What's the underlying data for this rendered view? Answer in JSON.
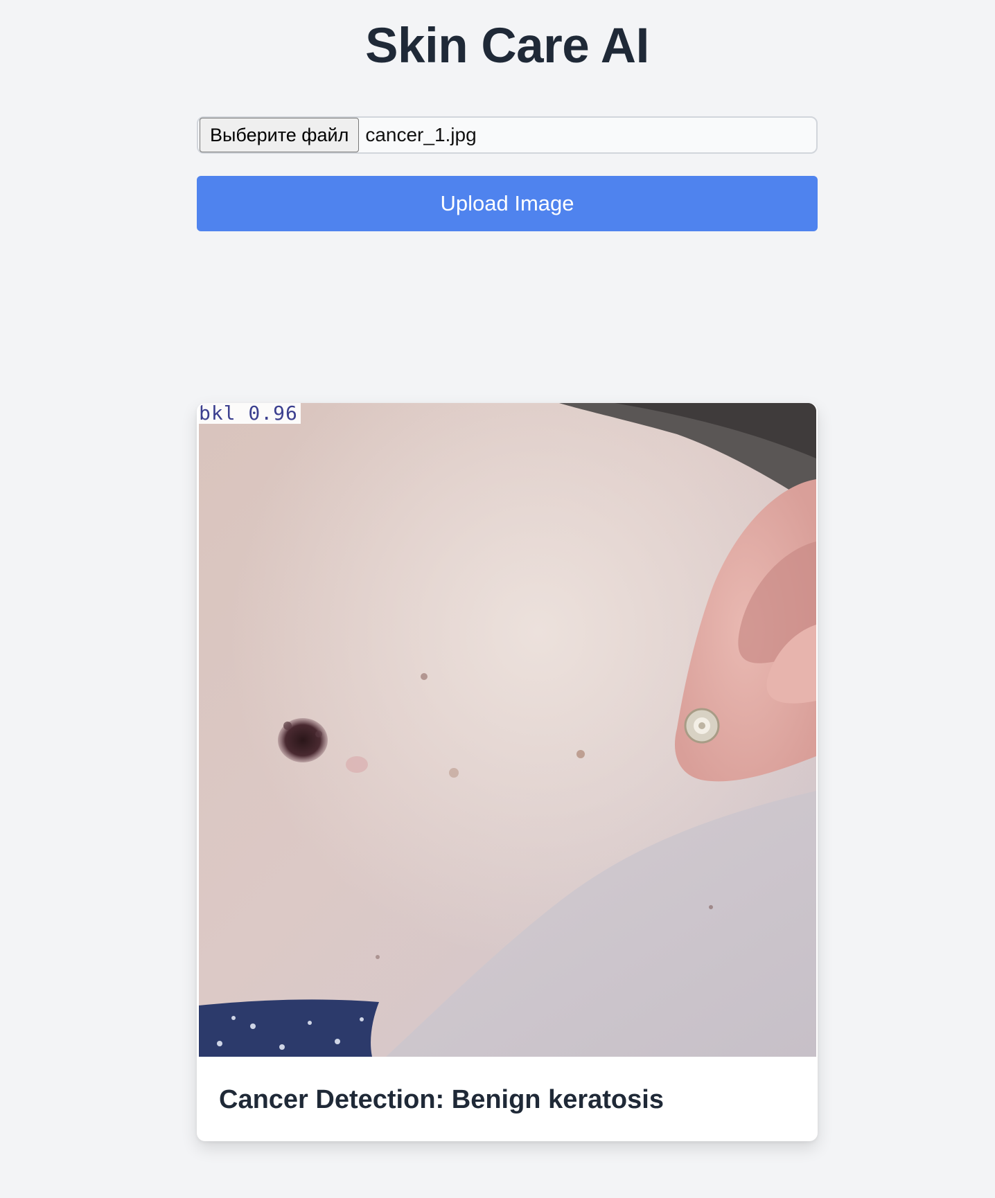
{
  "header": {
    "title": "Skin Care AI"
  },
  "upload_form": {
    "choose_file_label": "Выберите файл",
    "selected_file": "cancer_1.jpg",
    "upload_label": "Upload Image"
  },
  "result": {
    "detection_label": "bkl 0.96",
    "caption": "Cancer Detection: Benign keratosis"
  },
  "colors": {
    "background": "#f3f4f6",
    "accent": "#4f83ee",
    "text": "#1f2937"
  }
}
